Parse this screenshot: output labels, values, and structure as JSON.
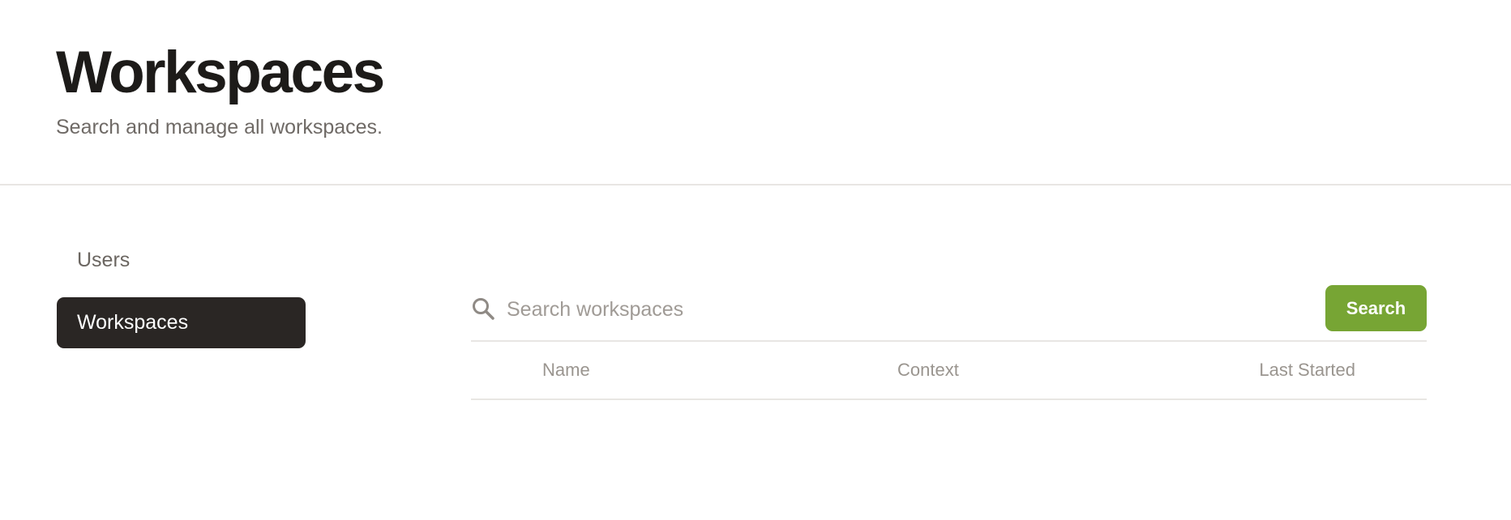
{
  "header": {
    "title": "Workspaces",
    "subtitle": "Search and manage all workspaces."
  },
  "sidebar": {
    "items": [
      {
        "label": "Users",
        "active": false
      },
      {
        "label": "Workspaces",
        "active": true
      }
    ]
  },
  "search": {
    "placeholder": "Search workspaces",
    "value": "",
    "button_label": "Search",
    "icon": "search-icon"
  },
  "table": {
    "columns": [
      "Name",
      "Context",
      "Last Started"
    ],
    "rows": []
  },
  "colors": {
    "accent": "#77a534",
    "active_nav_bg": "#2a2624",
    "title": "#1d1b19",
    "muted_text": "#6f6a66",
    "divider": "#e8e6e3"
  }
}
